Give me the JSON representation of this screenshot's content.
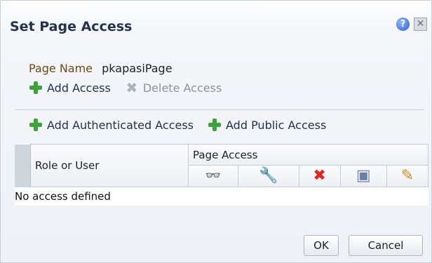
{
  "dialog": {
    "title": "Set Page Access",
    "help_icon_glyph": "?",
    "close_icon_glyph": "✕"
  },
  "page": {
    "name_label": "Page Name",
    "name_value": "pkapasiPage"
  },
  "actions": {
    "add_access": "Add Access",
    "delete_access": "Delete Access",
    "add_authenticated_access": "Add Authenticated Access",
    "add_public_access": "Add Public Access"
  },
  "table": {
    "column_role": "Role or User",
    "column_group_page_access": "Page Access",
    "permission_icons": [
      {
        "name": "view-icon",
        "glyph": "👓"
      },
      {
        "name": "customize-icon",
        "glyph": "🔧"
      },
      {
        "name": "delete-icon",
        "glyph": "✖"
      },
      {
        "name": "grant-icon",
        "glyph": "▣"
      },
      {
        "name": "edit-icon",
        "glyph": "✎"
      }
    ],
    "empty_message": "No access defined"
  },
  "buttons": {
    "ok": "OK",
    "cancel": "Cancel"
  },
  "colors": {
    "title": "#22344d",
    "add_icon": "#3ca23a",
    "delete_icon": "#e2241b"
  }
}
